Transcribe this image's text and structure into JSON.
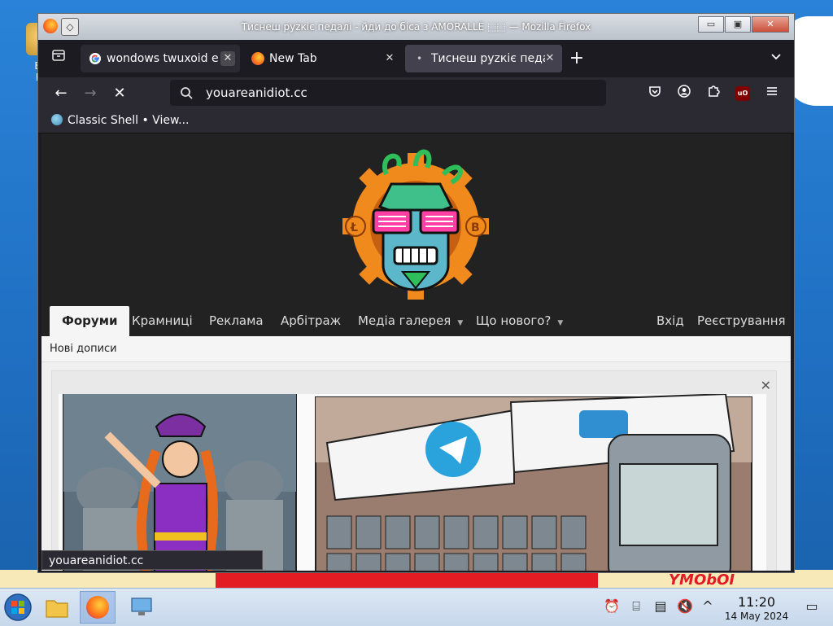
{
  "desktop": {
    "icon_label": "Big",
    "icon_label2": "De",
    "bottom_art_text": "YMObOI"
  },
  "window": {
    "title": "Тиснеш рyzкіє пeдaлі - йди до біса з AMORALLE ⬚⬚ — Mozilla Firefox",
    "sys_menu_glyph": "◇",
    "minimize": "▭",
    "maximize": "▣",
    "close": "✕"
  },
  "tabs": [
    {
      "label": "wondows twuxoid e",
      "close": "✕"
    },
    {
      "label": "New Tab",
      "close": "✕"
    },
    {
      "label": "Тиснеш рyzкіє пeда",
      "close": "✕",
      "indicator": "•"
    }
  ],
  "toolbar": {
    "new_tab": "+",
    "tab_list": "⌄",
    "back": "←",
    "forward": "→",
    "stop": "✕",
    "url": "youareanidiot.cc",
    "pocket_icon": "pocket-icon",
    "account_icon": "account-icon",
    "extensions_icon": "puzzle-icon",
    "ublock_label": "uO",
    "menu_icon": "hamburger-icon"
  },
  "bookmarks": [
    {
      "label": "Classic Shell • View..."
    }
  ],
  "site": {
    "nav": [
      {
        "label": "Форуми",
        "active": true
      },
      {
        "label": "Крамниці"
      },
      {
        "label": "Реклама"
      },
      {
        "label": "Арбітраж"
      },
      {
        "label": "Медіа галерея",
        "dropdown": true
      },
      {
        "label": "Що нового?",
        "dropdown": true
      }
    ],
    "login": "Вхід",
    "register": "Реєстрування",
    "subnav_link": "Нові дописи",
    "banner_close": "✕"
  },
  "status_bar": "youareanidiot.cc",
  "taskbar": {
    "time": "11:20",
    "date": "14 May 2024"
  },
  "colors": {
    "firefox_dark": "#1c1b22",
    "toolbar": "#2b2a33",
    "active_tab": "#42414d",
    "site_header": "#222222",
    "logo_orange": "#f08a1c",
    "glasses_pink": "#ff3fa4"
  }
}
